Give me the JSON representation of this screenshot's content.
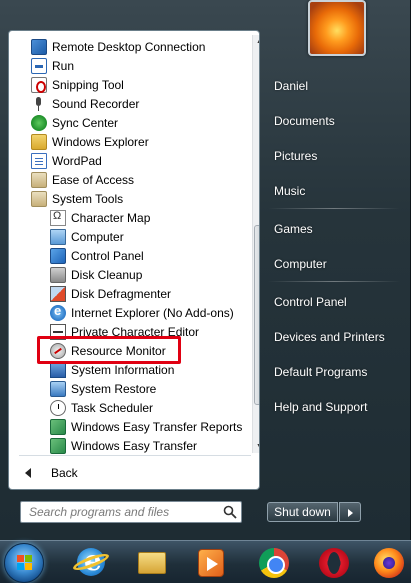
{
  "programs": [
    {
      "label": "Remote Desktop Connection",
      "icon": "remote-desktop-icon",
      "indent": 0
    },
    {
      "label": "Run",
      "icon": "run-icon",
      "indent": 0
    },
    {
      "label": "Snipping Tool",
      "icon": "scissors-icon",
      "indent": 0
    },
    {
      "label": "Sound Recorder",
      "icon": "microphone-icon",
      "indent": 0
    },
    {
      "label": "Sync Center",
      "icon": "sync-icon",
      "indent": 0
    },
    {
      "label": "Windows Explorer",
      "icon": "folder-icon",
      "indent": 0
    },
    {
      "label": "WordPad",
      "icon": "wordpad-icon",
      "indent": 0
    },
    {
      "label": "Ease of Access",
      "icon": "folder-icon",
      "indent": 0
    },
    {
      "label": "System Tools",
      "icon": "folder-open-icon",
      "indent": 0
    },
    {
      "label": "Character Map",
      "icon": "character-map-icon",
      "indent": 1
    },
    {
      "label": "Computer",
      "icon": "computer-icon",
      "indent": 1
    },
    {
      "label": "Control Panel",
      "icon": "control-panel-icon",
      "indent": 1
    },
    {
      "label": "Disk Cleanup",
      "icon": "disk-cleanup-icon",
      "indent": 1
    },
    {
      "label": "Disk Defragmenter",
      "icon": "defrag-icon",
      "indent": 1
    },
    {
      "label": "Internet Explorer (No Add-ons)",
      "icon": "internet-explorer-icon",
      "indent": 1
    },
    {
      "label": "Private Character Editor",
      "icon": "character-editor-icon",
      "indent": 1
    },
    {
      "label": "Resource Monitor",
      "icon": "resource-monitor-icon",
      "indent": 1,
      "highlighted": true
    },
    {
      "label": "System Information",
      "icon": "system-information-icon",
      "indent": 1
    },
    {
      "label": "System Restore",
      "icon": "system-restore-icon",
      "indent": 1
    },
    {
      "label": "Task Scheduler",
      "icon": "clock-icon",
      "indent": 1
    },
    {
      "label": "Windows Easy Transfer Reports",
      "icon": "easy-transfer-icon",
      "indent": 1
    },
    {
      "label": "Windows Easy Transfer",
      "icon": "easy-transfer-icon",
      "indent": 1
    }
  ],
  "back": {
    "label": "Back",
    "icon": "left-arrow-icon"
  },
  "search": {
    "placeholder": "Search programs and files",
    "icon": "magnifier-icon"
  },
  "user_picture": {
    "icon": "flower-picture-icon"
  },
  "right_column": [
    {
      "label": "Daniel"
    },
    {
      "label": "Documents"
    },
    {
      "label": "Pictures"
    },
    {
      "label": "Music"
    },
    {
      "label": "Games"
    },
    {
      "label": "Computer"
    },
    {
      "label": "Control Panel"
    },
    {
      "label": "Devices and Printers"
    },
    {
      "label": "Default Programs"
    },
    {
      "label": "Help and Support"
    }
  ],
  "shutdown": {
    "label": "Shut down",
    "arrow_icon": "right-triangle-icon"
  },
  "taskbar": {
    "items": [
      {
        "icon": "windows-start-orb-icon"
      },
      {
        "icon": "internet-explorer-icon"
      },
      {
        "icon": "file-explorer-folder-icon"
      },
      {
        "icon": "media-player-icon"
      },
      {
        "icon": "chrome-icon"
      },
      {
        "icon": "opera-icon"
      },
      {
        "icon": "firefox-icon"
      }
    ]
  },
  "colors": {
    "highlight_border": "#e00012",
    "start_menu_dark": "#26343b",
    "left_panel_bg": "#ffffff",
    "right_text": "#ffffff"
  }
}
